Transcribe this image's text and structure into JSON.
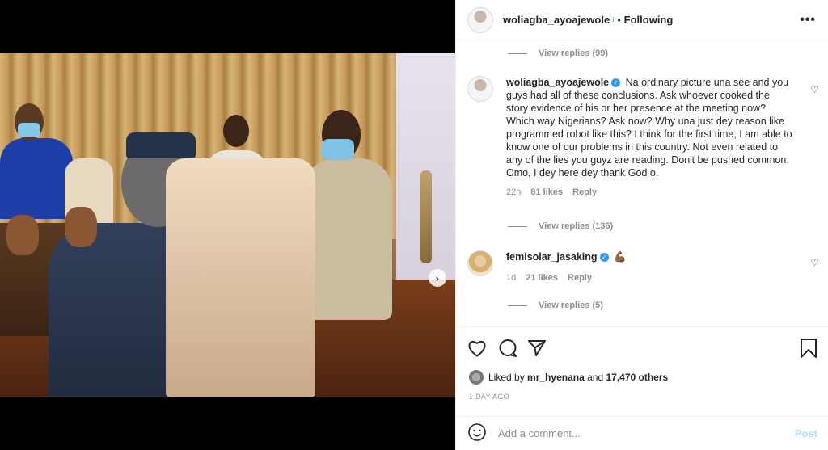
{
  "post": {
    "author": "woliagba_ayoajewole",
    "header_separator": "•",
    "following_label": "Following",
    "more_label": "•••",
    "carousel_dots": 2,
    "carousel_active": 1
  },
  "comments": [
    {
      "view_replies": "View replies (99)"
    },
    {
      "username": "woliagba_ayoajewole",
      "verified": true,
      "text": "Na ordinary picture una see and you guys had all of these conclusions. Ask whoever cooked the story evidence of his or her presence at the meeting now? Which way Nigerians? Ask now? Why una just dey reason like programmed robot like this? I think for the first time, I am able to know one of our problems in this country. Not even related to any of the lies you guyz are reading. Don't be pushed common. Omo, I dey here dey thank God o.",
      "time": "22h",
      "likes": "81 likes",
      "reply": "Reply",
      "view_replies": "View replies (136)"
    },
    {
      "username": "femisolar_jasaking",
      "verified": true,
      "text": "💪🏾",
      "time": "1d",
      "likes": "21 likes",
      "reply": "Reply",
      "view_replies": "View replies (5)"
    }
  ],
  "engagement": {
    "liked_by_prefix": "Liked by",
    "liked_by_user": "mr_hyenana",
    "liked_by_and": "and",
    "liked_by_others": "17,470 others",
    "timestamp": "1 DAY AGO"
  },
  "add_comment": {
    "placeholder": "Add a comment...",
    "post_label": "Post"
  },
  "colors": {
    "accent": "#3897f0",
    "post_disabled": "#b2dffc",
    "muted": "#8e8e8e"
  }
}
